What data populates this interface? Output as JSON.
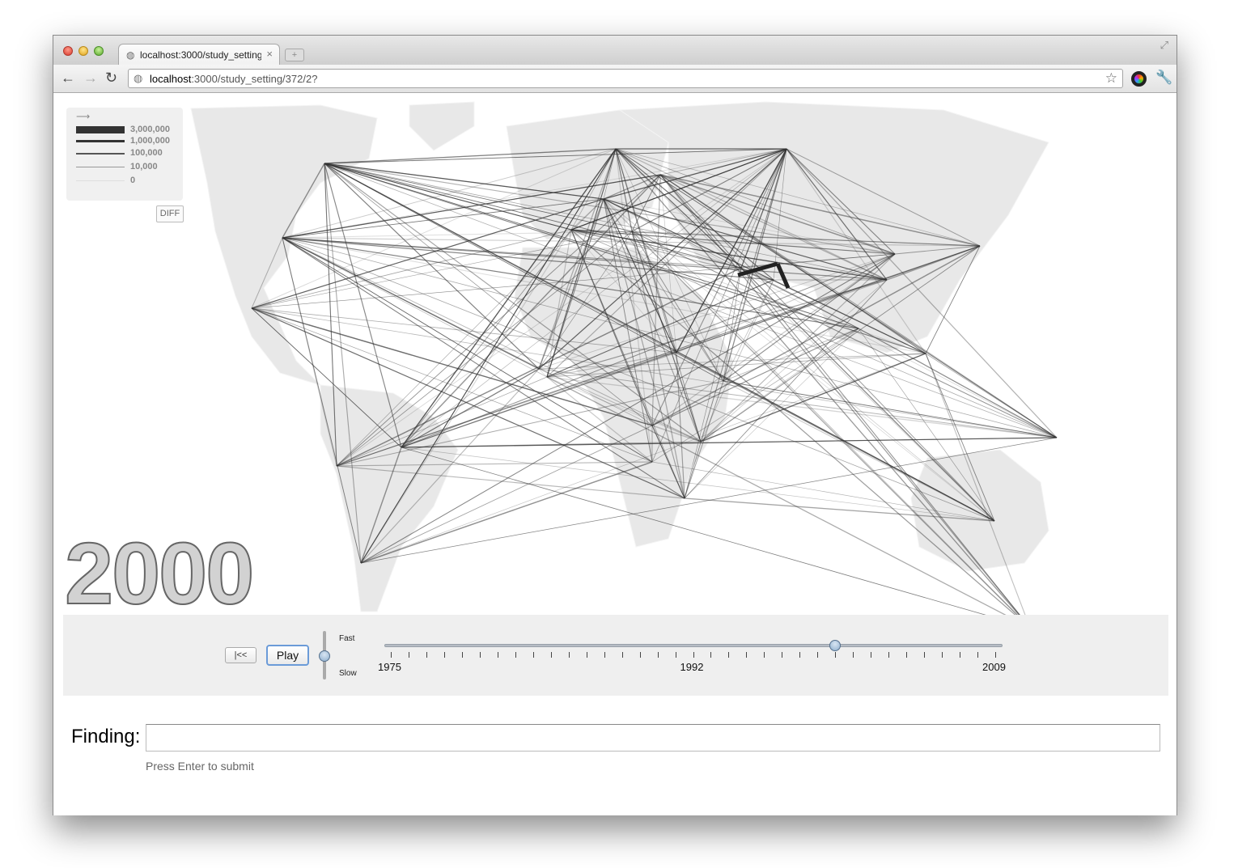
{
  "browser": {
    "tab_title": "localhost:3000/study_setting",
    "url_host": "localhost",
    "url_rest": ":3000/study_setting/372/2?",
    "tab_close": "×"
  },
  "legend": {
    "arrow_icon": "arrow-right",
    "entries": [
      {
        "label": "3,000,000",
        "weight": 3000000
      },
      {
        "label": "1,000,000",
        "weight": 1000000
      },
      {
        "label": "100,000",
        "weight": 100000
      },
      {
        "label": "10,000",
        "weight": 10000
      },
      {
        "label": "0",
        "weight": 0
      }
    ],
    "diff_label": "DIFF"
  },
  "year": "2000",
  "controls": {
    "reset_label": "|<<",
    "play_label": "Play",
    "speed_fast": "Fast",
    "speed_slow": "Slow",
    "speed_level": 0.5,
    "year_min": 1975,
    "year_max": 2009,
    "current_year": 2000,
    "tick_labels": [
      "1975",
      "1992",
      "2009"
    ]
  },
  "finding": {
    "label": "Finding:",
    "value": "",
    "help": "Press Enter to submit"
  },
  "colors": {
    "land": "#e6e6e6",
    "flow_line": "#333333",
    "control_bg": "#efefef"
  }
}
